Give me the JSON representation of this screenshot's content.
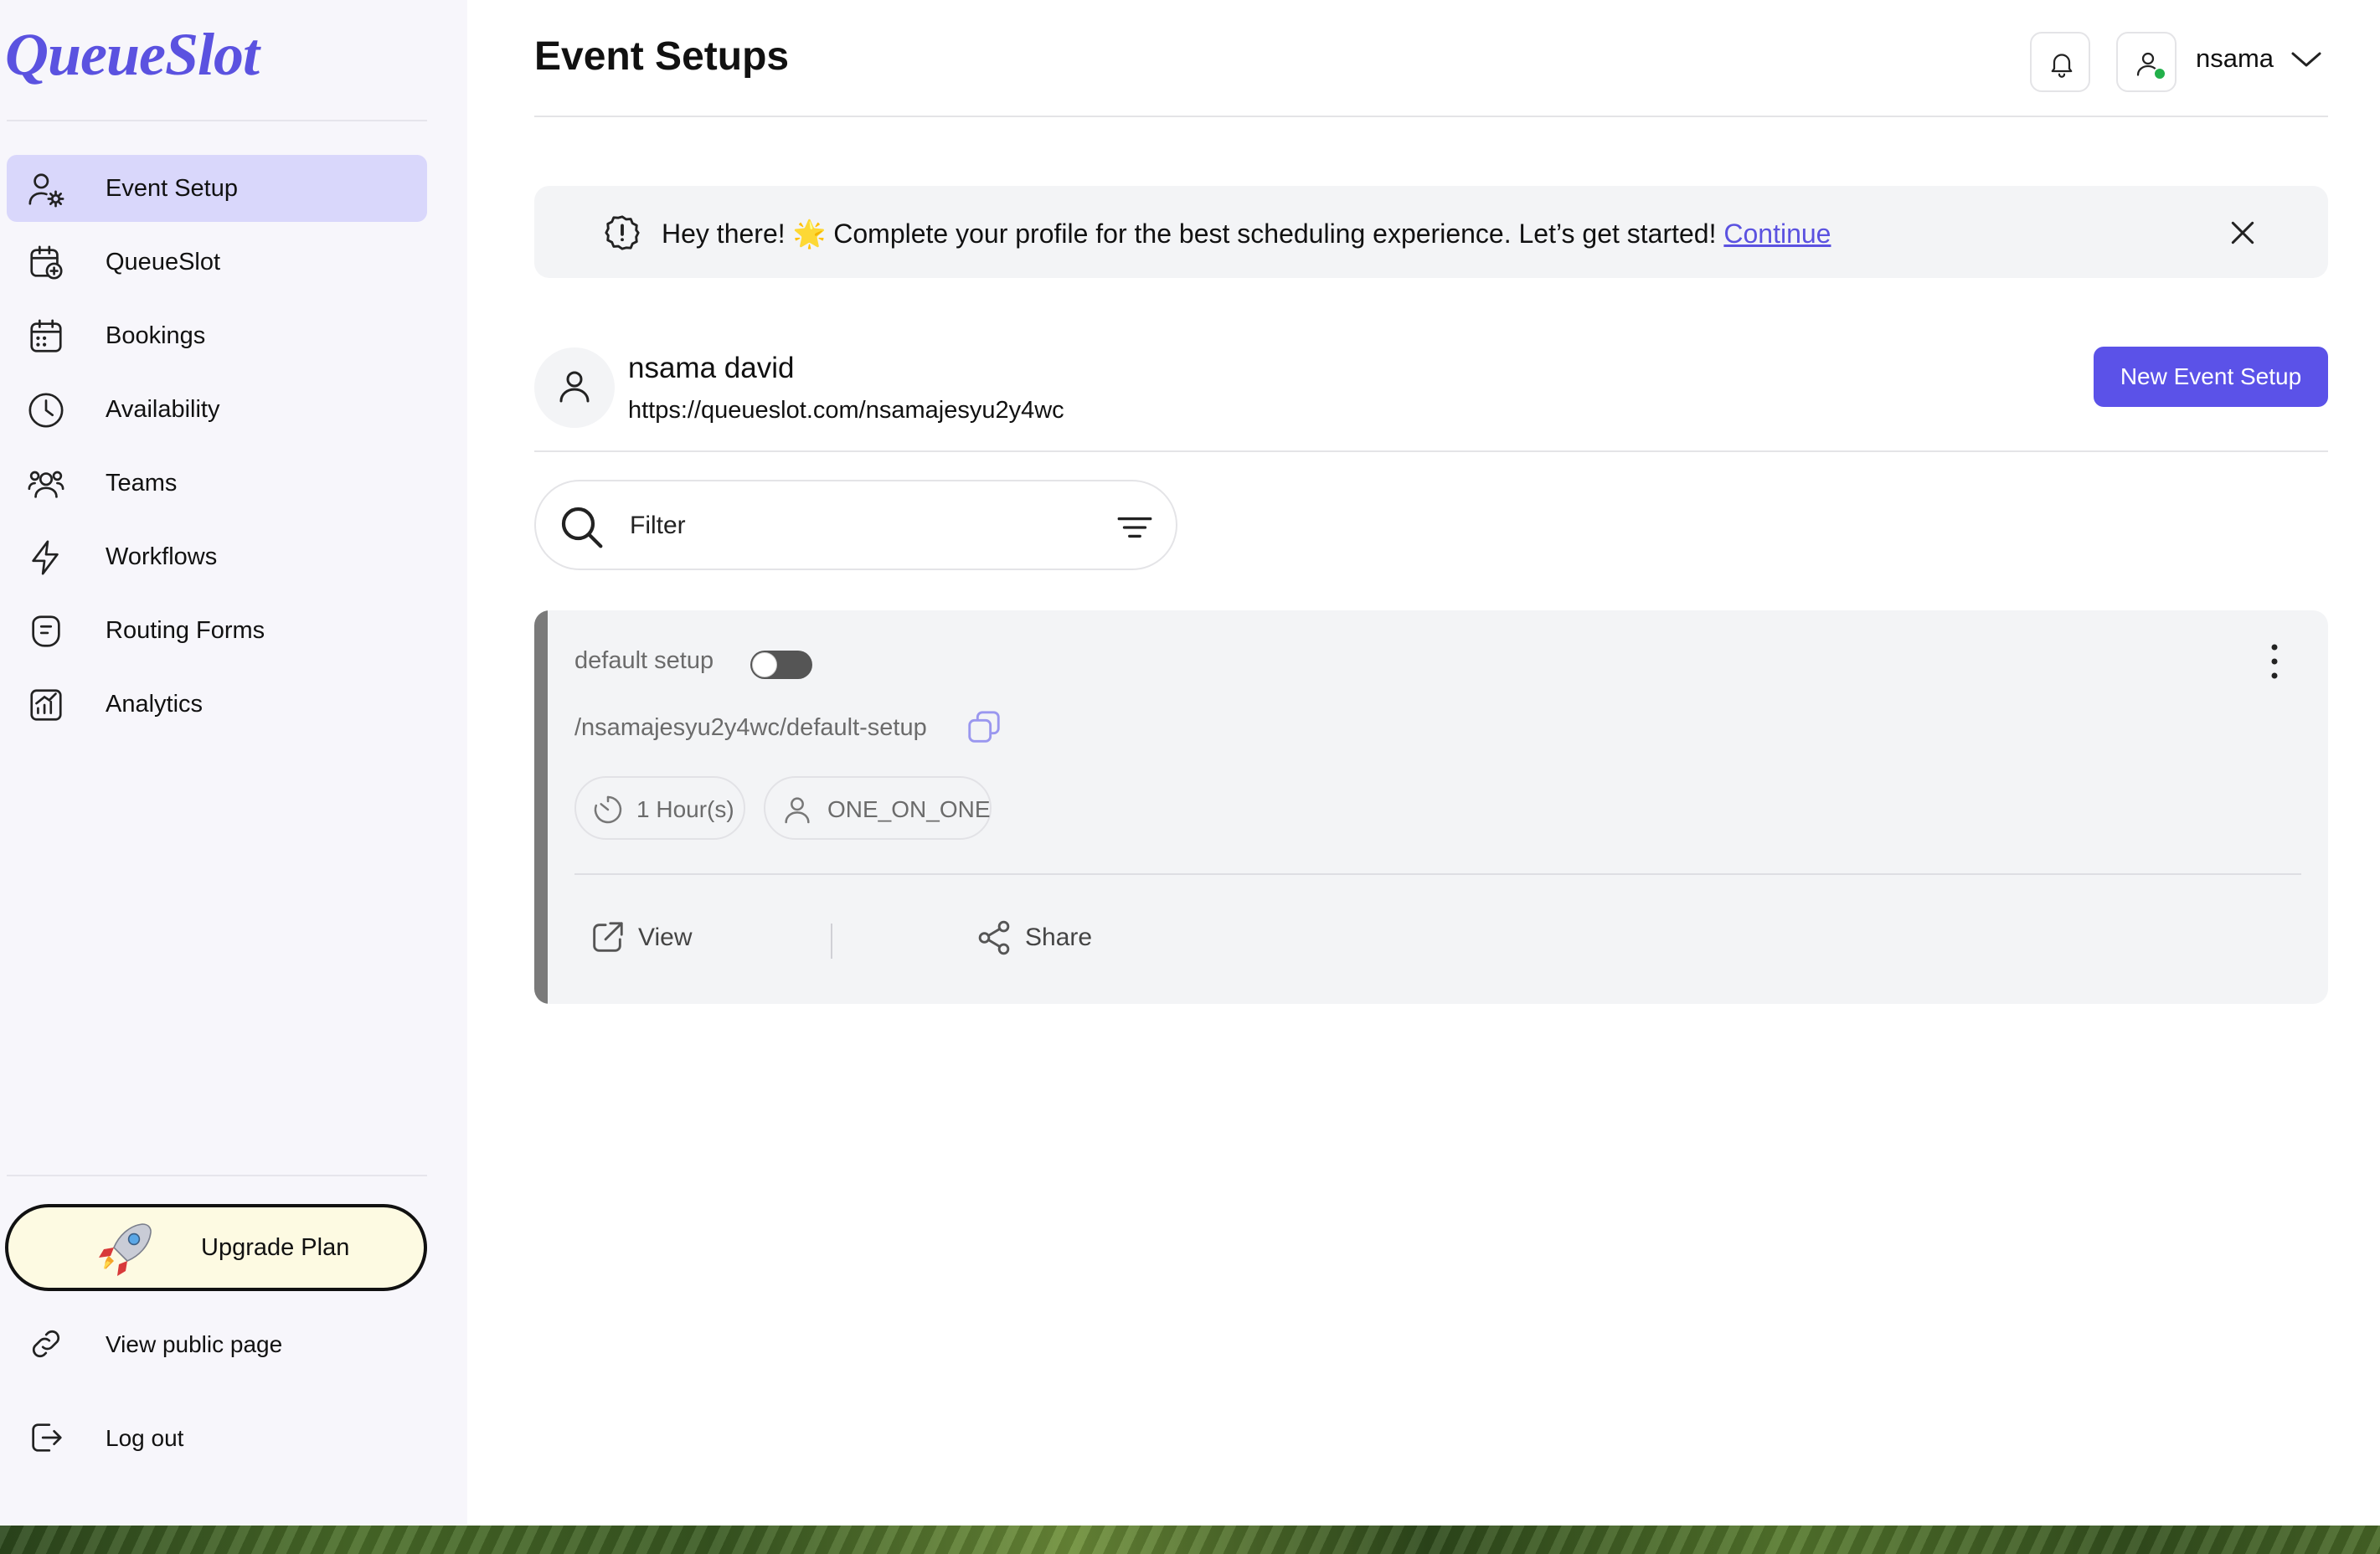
{
  "app": {
    "logo": "QueueSlot",
    "page_title": "Event Setups"
  },
  "sidebar": {
    "items": [
      {
        "label": "Event Setup",
        "icon": "user-gear-icon",
        "active": true
      },
      {
        "label": "QueueSlot",
        "icon": "calendar-plus-icon",
        "active": false
      },
      {
        "label": "Bookings",
        "icon": "calendar-icon",
        "active": false
      },
      {
        "label": "Availability",
        "icon": "clock-icon",
        "active": false
      },
      {
        "label": "Teams",
        "icon": "users-icon",
        "active": false
      },
      {
        "label": "Workflows",
        "icon": "lightning-icon",
        "active": false
      },
      {
        "label": "Routing Forms",
        "icon": "form-icon",
        "active": false
      },
      {
        "label": "Analytics",
        "icon": "chart-icon",
        "active": false
      }
    ],
    "upgrade_label": "Upgrade Plan",
    "public_page_label": "View public page",
    "logout_label": "Log out"
  },
  "header": {
    "user_name": "nsama",
    "status_color": "#22b04a"
  },
  "banner": {
    "text": "Hey there! 🌟 Complete your profile for the best scheduling experience. Let’s get started!",
    "link": "Continue"
  },
  "profile": {
    "name": "nsama david",
    "url": "https://queueslot.com/nsamajesyu2y4wc",
    "new_button": "New Event Setup"
  },
  "filter": {
    "placeholder": "Filter"
  },
  "events": [
    {
      "title": "default setup",
      "enabled": false,
      "path": "/nsamajesyu2y4wc/default-setup",
      "duration": "1 Hour(s)",
      "type": "ONE_ON_ONE",
      "view_label": "View",
      "share_label": "Share"
    }
  ],
  "colors": {
    "accent": "#5b52e8",
    "active_nav_bg": "#d9d7fb",
    "upgrade_bg": "#fdfae2"
  }
}
